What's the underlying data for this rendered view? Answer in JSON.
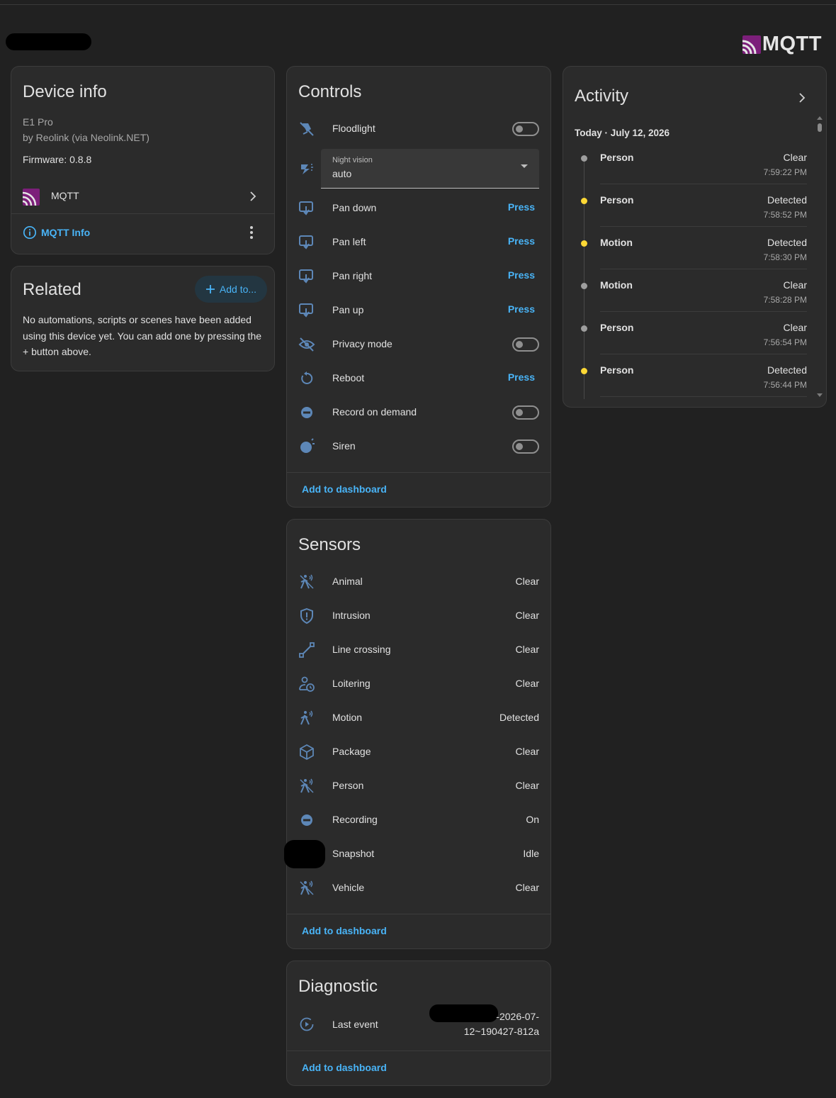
{
  "header": {
    "integration_logo_text": "MQTT"
  },
  "device_info": {
    "title": "Device info",
    "model": "E1 Pro",
    "manufacturer": "by Reolink (via Neolink.NET)",
    "firmware": "Firmware: 0.8.8",
    "integration_label": "MQTT",
    "info_link": "MQTT Info"
  },
  "related": {
    "title": "Related",
    "add_button": "Add to...",
    "text": "No automations, scripts or scenes have been added using this device yet. You can add one by pressing the + button above."
  },
  "controls": {
    "title": "Controls",
    "floodlight": "Floodlight",
    "night_vision": {
      "label": "Night vision",
      "value": "auto"
    },
    "pan_down": "Pan down",
    "pan_left": "Pan left",
    "pan_right": "Pan right",
    "pan_up": "Pan up",
    "privacy_mode": "Privacy mode",
    "reboot": "Reboot",
    "record_on_demand": "Record on demand",
    "siren": "Siren",
    "press_label": "Press",
    "add_to_dashboard": "Add to dashboard"
  },
  "sensors": {
    "title": "Sensors",
    "items": [
      {
        "name": "Animal",
        "value": "Clear",
        "icon": "walk-sensor-icon"
      },
      {
        "name": "Intrusion",
        "value": "Clear",
        "icon": "shield-alert-icon"
      },
      {
        "name": "Line crossing",
        "value": "Clear",
        "icon": "vector-line-icon"
      },
      {
        "name": "Loitering",
        "value": "Clear",
        "icon": "account-clock-icon"
      },
      {
        "name": "Motion",
        "value": "Detected",
        "icon": "motion-sensor-icon"
      },
      {
        "name": "Package",
        "value": "Clear",
        "icon": "package-icon"
      },
      {
        "name": "Person",
        "value": "Clear",
        "icon": "walk-sensor-icon"
      },
      {
        "name": "Recording",
        "value": "On",
        "icon": "record-rec-icon"
      },
      {
        "name": "Snapshot",
        "value": "Idle",
        "icon": "redacted-icon"
      },
      {
        "name": "Vehicle",
        "value": "Clear",
        "icon": "walk-sensor-icon"
      }
    ],
    "add_to_dashboard": "Add to dashboard"
  },
  "diagnostic": {
    "title": "Diagnostic",
    "last_event_label": "Last event",
    "last_event_value_line1": "-2026-07-",
    "last_event_value_line2": "12~190427-812a",
    "add_to_dashboard": "Add to dashboard"
  },
  "activity": {
    "title": "Activity",
    "date_header": "Today · July 12, 2026",
    "events": [
      {
        "name": "Person",
        "state": "Clear",
        "time": "7:59:22 PM",
        "dot_color": "#9e9e9e"
      },
      {
        "name": "Person",
        "state": "Detected",
        "time": "7:58:52 PM",
        "dot_color": "#fdd835"
      },
      {
        "name": "Motion",
        "state": "Detected",
        "time": "7:58:30 PM",
        "dot_color": "#fdd835"
      },
      {
        "name": "Motion",
        "state": "Clear",
        "time": "7:58:28 PM",
        "dot_color": "#9e9e9e"
      },
      {
        "name": "Person",
        "state": "Clear",
        "time": "7:56:54 PM",
        "dot_color": "#9e9e9e"
      },
      {
        "name": "Person",
        "state": "Detected",
        "time": "7:56:44 PM",
        "dot_color": "#fdd835"
      }
    ]
  },
  "colors": {
    "accent_link": "#49b4f7",
    "icon_blue": "#5d87b7",
    "background": "#212121",
    "card": "#2b2b2b"
  }
}
